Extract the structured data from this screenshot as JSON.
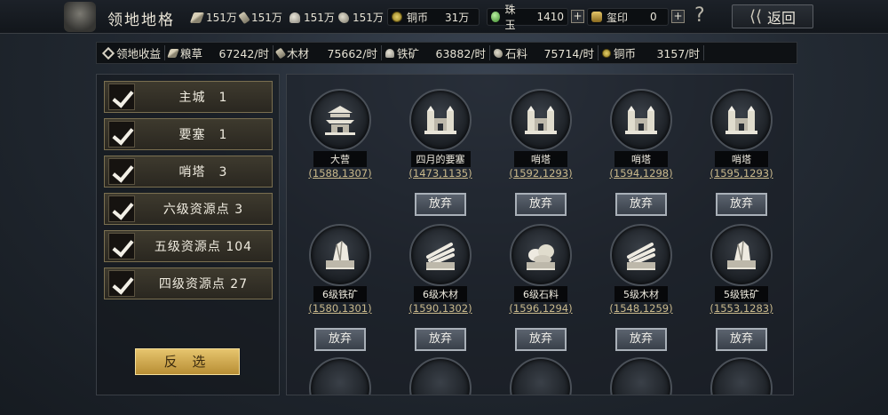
{
  "header": {
    "title": "领地地格",
    "resources": [
      {
        "icon": "grain-icon",
        "value": "151万"
      },
      {
        "icon": "wood-icon",
        "value": "151万"
      },
      {
        "icon": "iron-icon",
        "value": "151万"
      },
      {
        "icon": "stone-icon",
        "value": "151万"
      }
    ],
    "copper": {
      "label": "铜币",
      "value": "31万"
    },
    "jade": {
      "label": "珠玉",
      "value": "1410"
    },
    "seal": {
      "label": "玺印",
      "value": "0"
    },
    "help_label": "?",
    "back_label": "返回"
  },
  "income": {
    "label": "领地收益",
    "items": [
      {
        "icon": "grain-icon",
        "name": "粮草",
        "value": "67242/时"
      },
      {
        "icon": "wood-icon",
        "name": "木材",
        "value": "75662/时"
      },
      {
        "icon": "iron-icon",
        "name": "铁矿",
        "value": "63882/时"
      },
      {
        "icon": "stone-icon",
        "name": "石料",
        "value": "75714/时"
      },
      {
        "icon": "copper-icon",
        "name": "铜币",
        "value": "3157/时"
      }
    ]
  },
  "filters": [
    {
      "label": "主城　1",
      "checked": true
    },
    {
      "label": "要塞　1",
      "checked": true
    },
    {
      "label": "哨塔　3",
      "checked": true
    },
    {
      "label": "六级资源点 3",
      "checked": true
    },
    {
      "label": "五级资源点 104",
      "checked": true
    },
    {
      "label": "四级资源点 27",
      "checked": true
    }
  ],
  "invert_label": "反 选",
  "tiles": [
    {
      "type": "camp",
      "name": "大营",
      "coord": "(1588,1307)",
      "abandon": null
    },
    {
      "type": "fort",
      "name": "四月的要塞",
      "coord": "(1473,1135)",
      "abandon": "放弃"
    },
    {
      "type": "fort",
      "name": "哨塔",
      "coord": "(1592,1293)",
      "abandon": "放弃"
    },
    {
      "type": "fort",
      "name": "哨塔",
      "coord": "(1594,1298)",
      "abandon": "放弃"
    },
    {
      "type": "fort",
      "name": "哨塔",
      "coord": "(1595,1293)",
      "abandon": "放弃"
    },
    {
      "type": "iron",
      "name": "6级铁矿",
      "coord": "(1580,1301)",
      "abandon": "放弃"
    },
    {
      "type": "wood",
      "name": "6级木材",
      "coord": "(1590,1302)",
      "abandon": "放弃"
    },
    {
      "type": "stone",
      "name": "6级石料",
      "coord": "(1596,1294)",
      "abandon": "放弃"
    },
    {
      "type": "wood",
      "name": "5级木材",
      "coord": "(1548,1259)",
      "abandon": "放弃"
    },
    {
      "type": "iron",
      "name": "5级铁矿",
      "coord": "(1553,1283)",
      "abandon": "放弃"
    }
  ],
  "colors": {
    "accent_gold": "#e6c56e",
    "coord_text": "#c9b98c",
    "panel_border": "#3a3f46"
  }
}
